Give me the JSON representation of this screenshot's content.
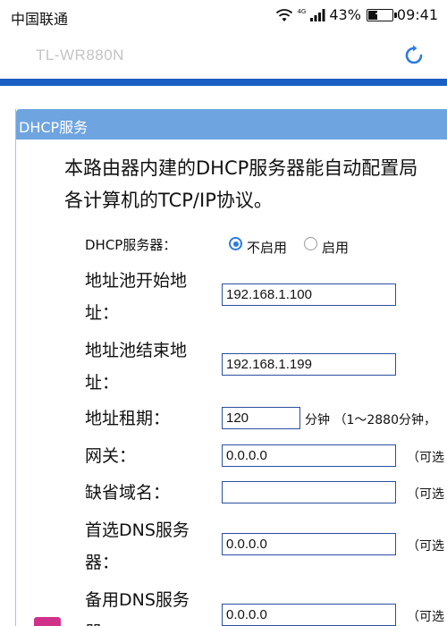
{
  "status_bar": {
    "carrier": "中国联通",
    "network_type": "4G",
    "battery": "43%",
    "battery_level": 0.43,
    "time": "09:41",
    "icons": [
      "wifi-icon",
      "signal-icon",
      "battery-icon"
    ]
  },
  "app": {
    "title": "TL-WR880N",
    "refresh_icon": "refresh-icon",
    "accent_color": "#1a5fc4"
  },
  "panel": {
    "title": "DHCP服务",
    "header_color": "#6ea4e0",
    "intro_line1": "本路由器内建的DHCP服务器能自动配置局",
    "intro_line2": "各计算机的TCP/IP协议。"
  },
  "form": {
    "dhcp_server": {
      "label": "DHCP服务器：",
      "options": [
        "不启用",
        "启用"
      ],
      "selected": "不启用"
    },
    "start_address": {
      "label_line1": "地址池开始地",
      "label_line2": "址：",
      "value": "192.168.1.100"
    },
    "end_address": {
      "label_line1": "地址池结束地",
      "label_line2": "址：",
      "value": "192.168.1.199"
    },
    "lease": {
      "label": "地址租期：",
      "value": "120",
      "note": "分钟 （1～2880分钟，"
    },
    "gateway": {
      "label": "网关：",
      "value": "0.0.0.0",
      "note": "（可选"
    },
    "domain": {
      "label": "缺省域名：",
      "value": "",
      "note": "（可选"
    },
    "primary_dns": {
      "label_line1": "首选DNS服务",
      "label_line2": "器：",
      "value": "0.0.0.0",
      "note": "（可选"
    },
    "secondary_dns": {
      "label_line1": "备用DNS服务",
      "label_line2": "器：",
      "value": "0.0.0.0",
      "note": "（可选"
    }
  }
}
